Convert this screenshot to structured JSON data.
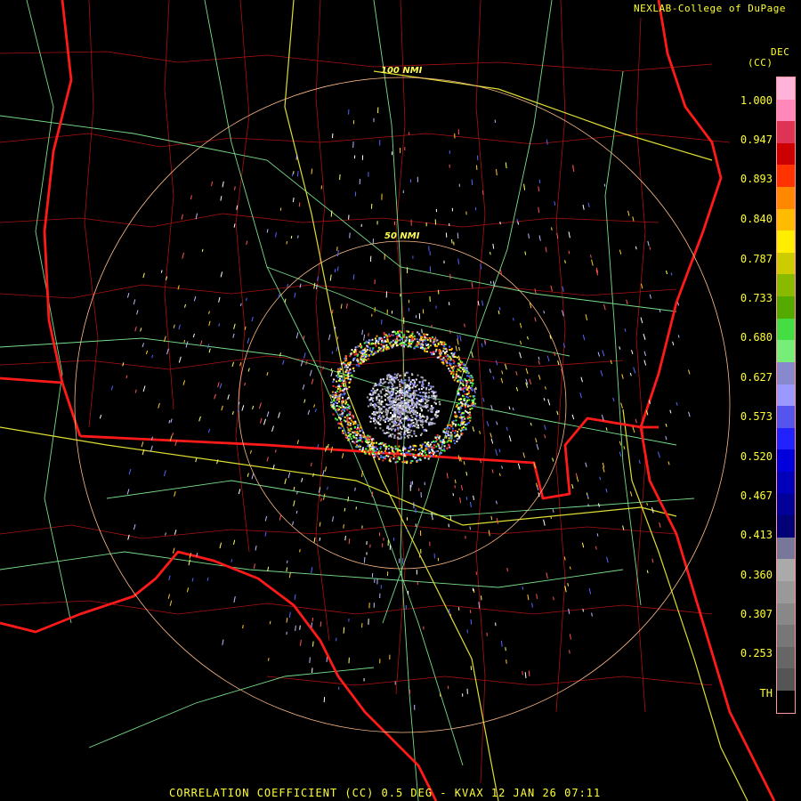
{
  "credit": "NEXLAB-College of DuPage",
  "footer": "CORRELATION COEFFICIENT (CC) 0.5 DEG - KVAX 12 JAN 26 07:11",
  "legend": {
    "title_line1": "DEC",
    "title_line2": "(CC)",
    "ticks": [
      "1.000",
      "0.947",
      "0.893",
      "0.840",
      "0.787",
      "0.733",
      "0.680",
      "0.627",
      "0.573",
      "0.520",
      "0.467",
      "0.413",
      "0.360",
      "0.307",
      "0.253",
      "TH"
    ],
    "colors": [
      "#ffb3d9",
      "#ff88bb",
      "#dd3355",
      "#cc0000",
      "#ff3300",
      "#ff8800",
      "#ffbb00",
      "#ffee00",
      "#cccc00",
      "#88bb00",
      "#55aa00",
      "#44dd44",
      "#77ee77",
      "#8888cc",
      "#9999ff",
      "#5555ee",
      "#2222ff",
      "#0000dd",
      "#0000bb",
      "#000099",
      "#000077",
      "#777799",
      "#aaaaaa",
      "#999999",
      "#888888",
      "#777777",
      "#666666",
      "#555555",
      "#000000"
    ]
  },
  "range_rings": {
    "ring_100": "100 NMI",
    "ring_50": "50 NMI"
  }
}
